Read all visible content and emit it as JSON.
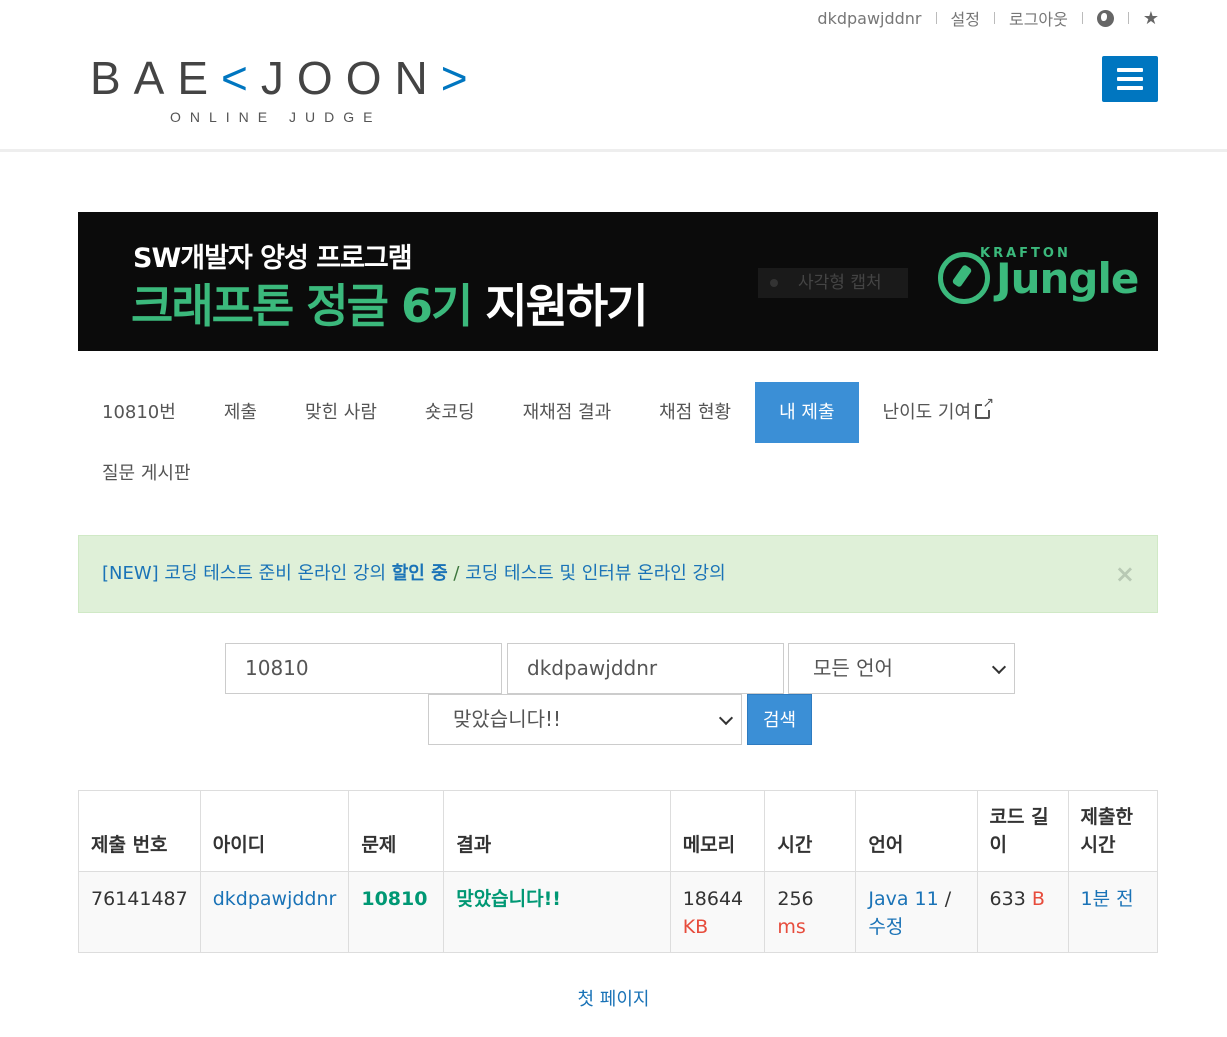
{
  "topbar": {
    "username": "dkdpawjddnr",
    "settings": "설정",
    "logout": "로그아웃"
  },
  "logo": {
    "main_a": "BAE",
    "main_b": "<",
    "main_c": "JOON",
    "main_d": ">",
    "sub": "ONLINE JUDGE"
  },
  "banner": {
    "line1": "SW개발자 양성 프로그램",
    "line2_green": "크래프톤 정글 6기",
    "line2_white": "지원하기",
    "overlay_text": "사각형 캡처",
    "brand_top": "KRAFTON",
    "brand_name": "Jungle"
  },
  "tabs": [
    {
      "label": "10810번"
    },
    {
      "label": "제출"
    },
    {
      "label": "맞힌 사람"
    },
    {
      "label": "숏코딩"
    },
    {
      "label": "재채점 결과"
    },
    {
      "label": "채점 현황"
    },
    {
      "label": "내 제출"
    },
    {
      "label": "난이도 기여"
    },
    {
      "label": "질문 게시판"
    }
  ],
  "alert": {
    "part1": "[NEW] 코딩 테스트 준비 온라인 강의 ",
    "part1_bold": "할인 중",
    "slash": " / ",
    "part2": "코딩 테스트 및 인터뷰 온라인 강의",
    "close": "×"
  },
  "form": {
    "problem_value": "10810",
    "user_value": "dkdpawjddnr",
    "language_selected": "모든 언어",
    "result_selected": "맞았습니다!!",
    "search_label": "검색"
  },
  "table": {
    "headers": [
      "제출 번호",
      "아이디",
      "문제",
      "결과",
      "메모리",
      "시간",
      "언어",
      "코드 길이",
      "제출한 시간"
    ],
    "rows": [
      {
        "submission_id": "76141487",
        "user": "dkdpawjddnr",
        "problem": "10810",
        "result": "맞았습니다!!",
        "memory": "18644",
        "memory_unit": "KB",
        "time": "256",
        "time_unit": "ms",
        "language": "Java 11",
        "edit": "수정",
        "code_length": "633",
        "code_unit": "B",
        "submitted": "1분 전"
      }
    ]
  },
  "pagination": {
    "first_page": "첫 페이지"
  }
}
